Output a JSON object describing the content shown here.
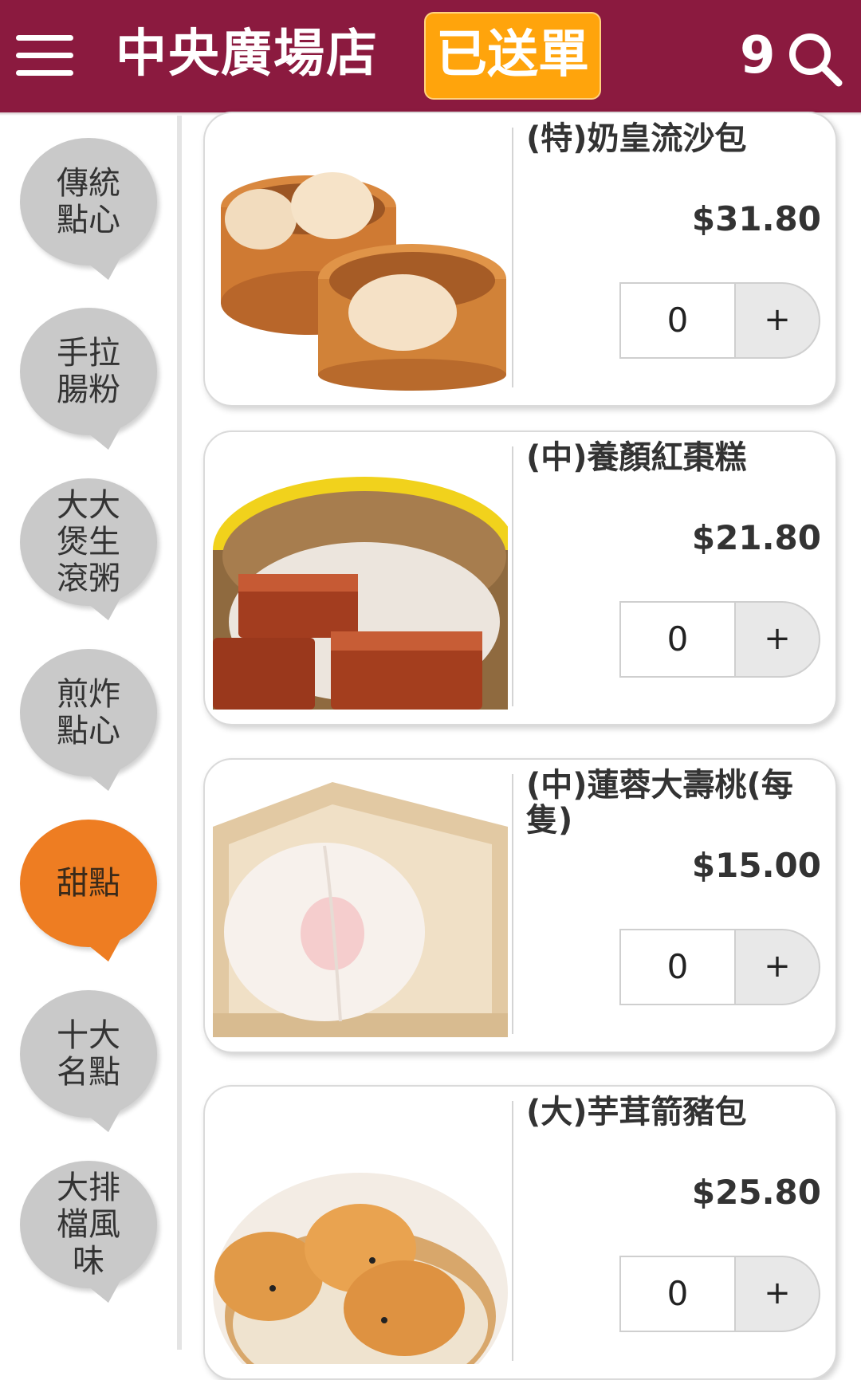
{
  "header": {
    "store_name": "中央廣場店",
    "order_status": "已送單",
    "cart_count": "9"
  },
  "colors": {
    "header_bg": "#8b1a3f",
    "status_button": "#ffa40c",
    "category_active": "#ee7d22",
    "category_inactive": "#c9c9c9"
  },
  "sidebar": {
    "categories": [
      {
        "label": "傳統點心"
      },
      {
        "label": "手拉腸粉"
      },
      {
        "label": "大大煲生滾粥"
      },
      {
        "label": "煎炸點心"
      },
      {
        "label": "甜點",
        "active": true
      },
      {
        "label": "十大名點"
      },
      {
        "label": "大排檔風味"
      }
    ]
  },
  "items": [
    {
      "name": "(特)奶皇流沙包",
      "price": "$31.80",
      "qty": "0",
      "add_label": "+",
      "image_icon": "steamed-custard-bun-image"
    },
    {
      "name": "(中)養顏紅棗糕",
      "price": "$21.80",
      "qty": "0",
      "add_label": "+",
      "image_icon": "red-date-cake-image"
    },
    {
      "name": "(中)蓮蓉大壽桃(每隻)",
      "price": "$15.00",
      "qty": "0",
      "add_label": "+",
      "image_icon": "longevity-peach-bun-image"
    },
    {
      "name": "(大)芋茸箭豬包",
      "price": "$25.80",
      "qty": "0",
      "add_label": "+",
      "image_icon": "hedgehog-taro-bun-image"
    }
  ]
}
